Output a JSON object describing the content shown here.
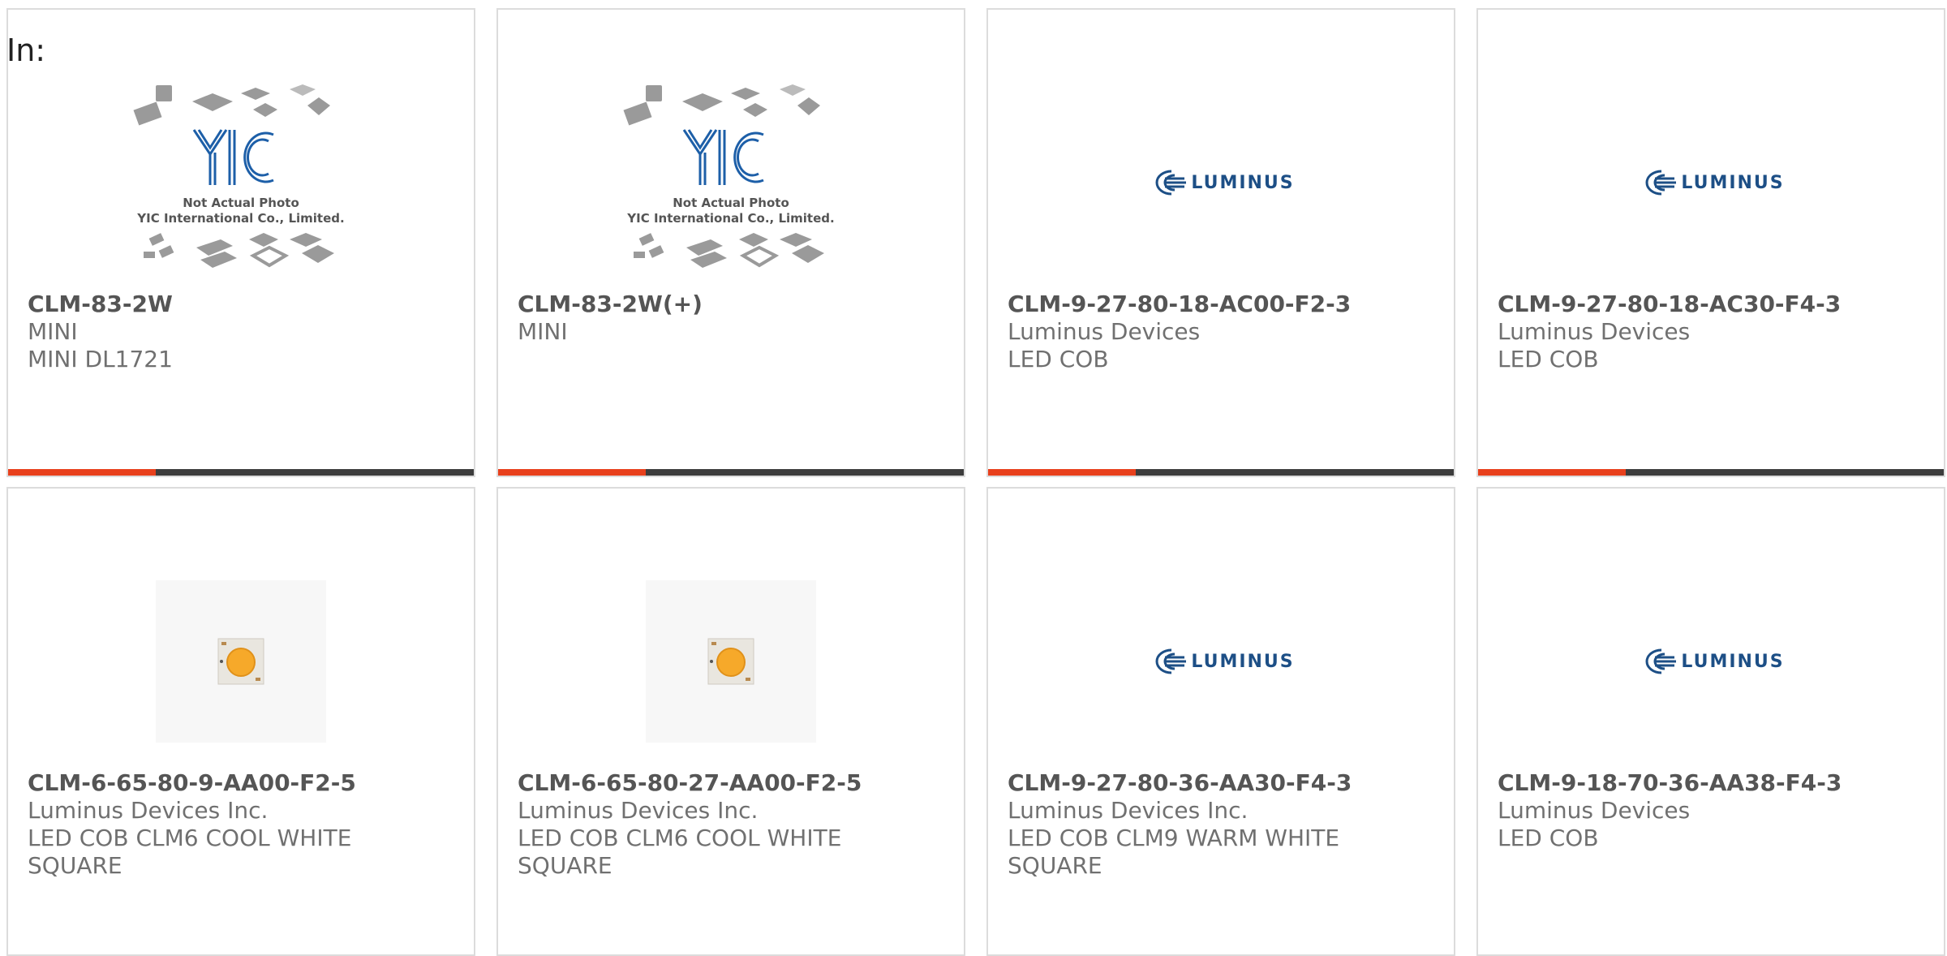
{
  "header": {
    "label": "In:"
  },
  "logos": {
    "yic_line1": "Not Actual Photo",
    "yic_line2": "YIC International Co., Limited.",
    "yic_mark": "YIC",
    "luminus_text": "LUMINUS"
  },
  "colors": {
    "accent": "#e8401c",
    "bar": "#3d3d3d",
    "luminus_blue": "#1d4f86"
  },
  "cards": [
    {
      "part_number": "CLM-83-2W",
      "manufacturer": "MINI",
      "description": "MINI DL1721",
      "description2": "",
      "image": "yic-placeholder"
    },
    {
      "part_number": "CLM-83-2W(+)",
      "manufacturer": "MINI",
      "description": "",
      "description2": "",
      "image": "yic-placeholder"
    },
    {
      "part_number": "CLM-9-27-80-18-AC00-F2-3",
      "manufacturer": "Luminus Devices",
      "description": "LED COB",
      "description2": "",
      "image": "luminus-logo"
    },
    {
      "part_number": "CLM-9-27-80-18-AC30-F4-3",
      "manufacturer": "Luminus Devices",
      "description": "LED COB",
      "description2": "",
      "image": "luminus-logo"
    },
    {
      "part_number": "CLM-6-65-80-9-AA00-F2-5",
      "manufacturer": "Luminus Devices Inc.",
      "description": "LED COB CLM6 COOL WHITE",
      "description2": "SQUARE",
      "image": "led-cob-photo"
    },
    {
      "part_number": "CLM-6-65-80-27-AA00-F2-5",
      "manufacturer": "Luminus Devices Inc.",
      "description": "LED COB CLM6 COOL WHITE",
      "description2": "SQUARE",
      "image": "led-cob-photo"
    },
    {
      "part_number": "CLM-9-27-80-36-AA30-F4-3",
      "manufacturer": "Luminus Devices Inc.",
      "description": "LED COB CLM9 WARM WHITE",
      "description2": "SQUARE",
      "image": "luminus-logo"
    },
    {
      "part_number": "CLM-9-18-70-36-AA38-F4-3",
      "manufacturer": "Luminus Devices",
      "description": "LED COB",
      "description2": "",
      "image": "luminus-logo"
    }
  ]
}
